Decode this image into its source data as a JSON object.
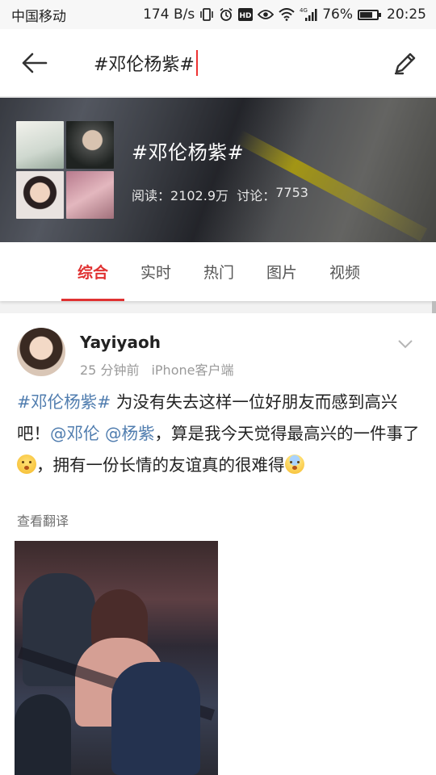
{
  "status_bar": {
    "carrier": "中国移动",
    "speed": "174 B/s",
    "network": "4G",
    "battery": "76%",
    "battery_level": 0.76,
    "time": "20:25",
    "icons": [
      "vibrate-icon",
      "alarm-icon",
      "hd-icon",
      "eye-icon",
      "wifi-icon",
      "signal-icon",
      "battery-icon"
    ]
  },
  "header": {
    "search_value": "#邓伦杨紫#",
    "back_icon": "back-arrow-icon",
    "edit_icon": "edit-pencil-icon"
  },
  "topic": {
    "title": "#邓伦杨紫#",
    "reads_label": "阅读：",
    "reads_value": "2102.9万",
    "discuss_label": "讨论：",
    "discuss_value": "7753"
  },
  "tabs": [
    {
      "label": "综合",
      "active": true
    },
    {
      "label": "实时",
      "active": false
    },
    {
      "label": "热门",
      "active": false
    },
    {
      "label": "图片",
      "active": false
    },
    {
      "label": "视频",
      "active": false
    }
  ],
  "post": {
    "username": "Yayiyaoh",
    "time": "25 分钟前",
    "source": "iPhone客户端",
    "hashtag": "#邓伦杨紫#",
    "text_1": " 为没有失去这样一位好朋友而感到高兴吧！",
    "mention_1": "@邓伦",
    "mention_2": "@杨紫",
    "text_2": "，算是我今天觉得最高兴的一件事了",
    "text_3": "，拥有一份长情的友谊真的很难得",
    "translate": "查看翻译"
  },
  "colors": {
    "accent": "#e03232",
    "link": "#507daf"
  }
}
